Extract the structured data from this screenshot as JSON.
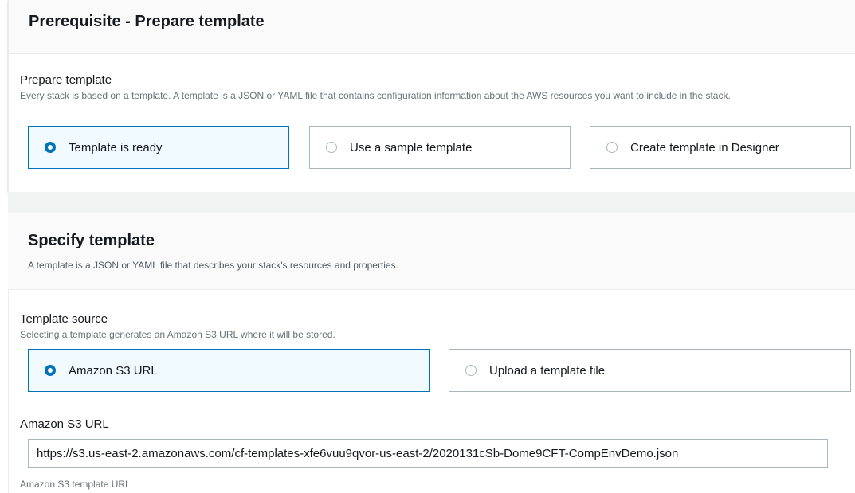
{
  "prerequisite": {
    "title": "Prerequisite - Prepare template",
    "field_label": "Prepare template",
    "field_desc": "Every stack is based on a template. A template is a JSON or YAML file that contains configuration information about the AWS resources you want to include in the stack.",
    "options": [
      {
        "label": "Template is ready",
        "selected": true
      },
      {
        "label": "Use a sample template",
        "selected": false
      },
      {
        "label": "Create template in Designer",
        "selected": false
      }
    ]
  },
  "specify": {
    "title": "Specify template",
    "desc": "A template is a JSON or YAML file that describes your stack's resources and properties.",
    "source_label": "Template source",
    "source_desc": "Selecting a template generates an Amazon S3 URL where it will be stored.",
    "options": [
      {
        "label": "Amazon S3 URL",
        "selected": true
      },
      {
        "label": "Upload a template file",
        "selected": false
      }
    ],
    "url_label": "Amazon S3 URL",
    "url_value": "https://s3.us-east-2.amazonaws.com/cf-templates-xfe6vuu9qvor-us-east-2/2020131cSb-Dome9CFT-CompEnvDemo.json",
    "url_hint": "Amazon S3 template URL"
  },
  "colors": {
    "accent": "#0073bb",
    "selected_bg": "#f1faff",
    "border": "#aab7b8"
  }
}
